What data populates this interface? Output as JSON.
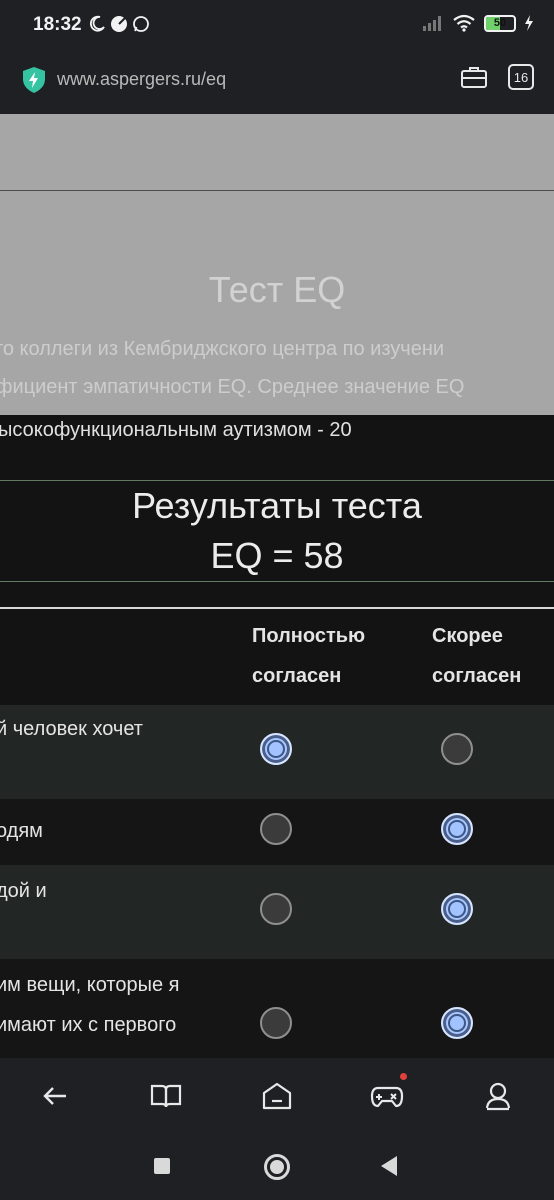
{
  "status_bar": {
    "time": "18:32",
    "battery": "50",
    "battery_level": 0.5,
    "icons": [
      "moon-icon",
      "pie-icon",
      "whatsapp-icon",
      "signal-icon",
      "wifi-icon",
      "battery-icon",
      "charging-icon"
    ]
  },
  "url_bar": {
    "url": "www.aspergers.ru/eq",
    "tabs_count": "16",
    "icons": [
      "shield-bolt-icon",
      "briefcase-icon",
      "tab-switcher-icon"
    ]
  },
  "overlay": {
    "title": "Тест EQ",
    "line1": "го коллеги из Кембриджского центра по изучени",
    "line2": "фициент эмпатичности EQ. Среднее значение EQ"
  },
  "intro_tail": "ысокофункциональным аутизмом - 20",
  "results": {
    "title": "Результаты теста",
    "score": "EQ = 58"
  },
  "table": {
    "headers": [
      [
        "Полностью",
        "согласен"
      ],
      [
        "Скорее",
        "согласен"
      ]
    ],
    "rows": [
      {
        "lines": [
          "й человек хочет",
          ""
        ],
        "selected": 0
      },
      {
        "lines": [
          "одям"
        ],
        "selected": 1
      },
      {
        "lines": [
          "дой и",
          ""
        ],
        "selected": 1
      },
      {
        "lines": [
          "им вещи, которые я",
          "имают их с первого"
        ],
        "selected": 1
      }
    ]
  },
  "bottom_nav": {
    "icons": [
      "back-arrow-icon",
      "book-icon",
      "home-tab-icon",
      "gamepad-icon",
      "profile-icon"
    ],
    "notification_color": "#e0413a"
  },
  "system_nav": {
    "icons": [
      "recents-icon",
      "home-icon",
      "back-icon"
    ]
  },
  "colors": {
    "accent_radio": "#a9c8ff",
    "divider_green": "#627a61"
  }
}
